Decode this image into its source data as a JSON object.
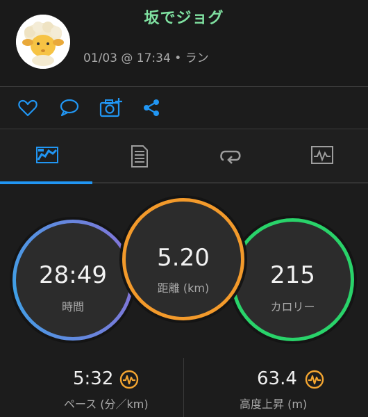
{
  "activity": {
    "title": "坂でジョグ",
    "meta": "01/03 @ 17:34 • ラン"
  },
  "actions": [
    "like-icon",
    "comment-icon",
    "add-photo-icon",
    "share-icon"
  ],
  "tabs": [
    {
      "name": "overview",
      "icon": "overview-icon",
      "active": true
    },
    {
      "name": "details",
      "icon": "document-list-icon",
      "active": false
    },
    {
      "name": "laps",
      "icon": "loop-icon",
      "active": false
    },
    {
      "name": "charts",
      "icon": "chart-icon",
      "active": false
    }
  ],
  "stats": {
    "time": {
      "value": "28:49",
      "label": "時間",
      "ring_color_top": "#3fa0e6",
      "ring_color_bottom": "#8a6fd6"
    },
    "distance": {
      "value": "5.20",
      "label": "距離 (km)",
      "ring_color": "#f39a2b"
    },
    "calories": {
      "value": "215",
      "label": "カロリー",
      "ring_color": "#29d36a"
    }
  },
  "bottom": {
    "pace": {
      "value": "5:32",
      "label": "ペース (分／km)"
    },
    "elevation": {
      "value": "63.4",
      "label": "高度上昇 (m)"
    }
  },
  "colors": {
    "accent": "#2196f3",
    "title": "#7fe0a0",
    "badge": "#f3a531"
  }
}
